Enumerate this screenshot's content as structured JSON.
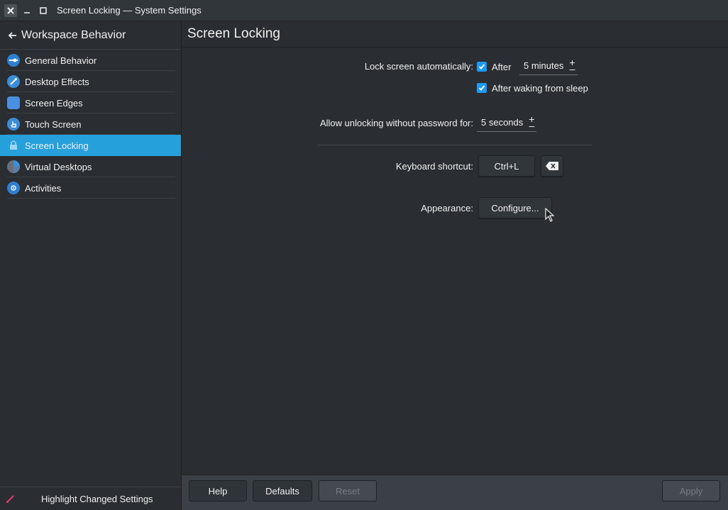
{
  "window": {
    "title": "Screen Locking — System Settings"
  },
  "sidebar": {
    "header": "Workspace Behavior",
    "items": [
      {
        "label": "General Behavior",
        "icon": "general-behavior-icon"
      },
      {
        "label": "Desktop Effects",
        "icon": "desktop-effects-icon"
      },
      {
        "label": "Screen Edges",
        "icon": "screen-edges-icon"
      },
      {
        "label": "Touch Screen",
        "icon": "touch-screen-icon"
      },
      {
        "label": "Screen Locking",
        "icon": "lock-icon",
        "active": true
      },
      {
        "label": "Virtual Desktops",
        "icon": "virtual-desktops-icon"
      },
      {
        "label": "Activities",
        "icon": "activities-icon"
      }
    ],
    "footer": "Highlight Changed Settings"
  },
  "main": {
    "title": "Screen Locking",
    "lock_auto_label": "Lock screen automatically:",
    "after_label": "After",
    "after_value": "5 minutes",
    "after_waking_label": "After waking from sleep",
    "allow_unlock_label": "Allow unlocking without password for:",
    "allow_unlock_value": "5 seconds",
    "shortcut_label": "Keyboard shortcut:",
    "shortcut_value": "Ctrl+L",
    "appearance_label": "Appearance:",
    "configure_label": "Configure..."
  },
  "footer_buttons": {
    "help": "Help",
    "defaults": "Defaults",
    "reset": "Reset",
    "apply": "Apply"
  },
  "colors": {
    "accent": "#1d99f3",
    "selection": "#26a0da",
    "background": "#2a2e32"
  }
}
